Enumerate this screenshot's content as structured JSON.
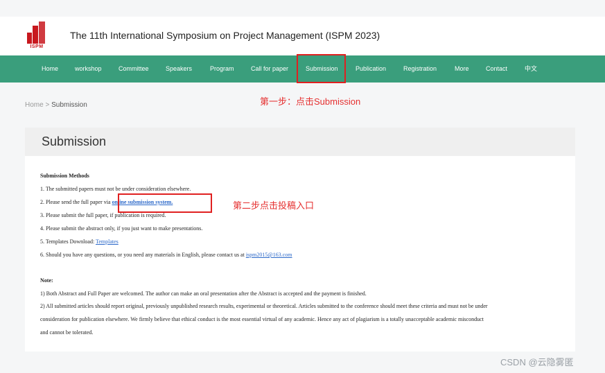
{
  "header": {
    "logo_text": "ISPM",
    "title": "The 11th International Symposium on Project Management (ISPM 2023)"
  },
  "nav": {
    "items": [
      "Home",
      "workshop",
      "Committee",
      "Speakers",
      "Program",
      "Call for paper",
      "Submission",
      "Publication",
      "Registration",
      "More",
      "Contact",
      "中文"
    ]
  },
  "annotations": {
    "step1": "第一步：点击Submission",
    "step2": "第二步点击投稿入口"
  },
  "breadcrumb": {
    "home": "Home",
    "separator": ">",
    "current": "Submission"
  },
  "page_title": "Submission",
  "methods": {
    "heading": "Submission Methods",
    "item1": "1. The submitted papers must not be under consideration elsewhere.",
    "item2_prefix": "2. Please send the full paper via ",
    "item2_link": "online submission system.",
    "item3": "3. Please submit the full paper, if publication is required.",
    "item4": "4. Please submit the abstract only, if you just want to make presentations.",
    "item5_prefix": "5. Templates Download: ",
    "item5_link": "Templates",
    "item6_prefix": "6. Should you have any questions, or you need any materials in English, please contact us at ",
    "item6_link": "ispm2015@163.com"
  },
  "note": {
    "heading": "Note:",
    "line1": "1) Both Abstract and Full Paper are welcomed. The author can make an oral presentation after the Abstract is accepted and the payment is finished.",
    "line2a": "2) All submitted articles should report original, previously unpublished research results, experimental or theoretical. Articles submitted to the conference should meet these criteria and must not be under",
    "line2b": "consideration for publication elsewhere. We firmly believe that ethical conduct is the most essential virtual of any academic. Hence any act of plagiarism is a totally unacceptable academic misconduct",
    "line2c": "and cannot be tolerated."
  },
  "watermark": "CSDN @云隐雾匿",
  "colors": {
    "nav_bg": "#3a9e7c",
    "annotation_red": "#e53030",
    "link_blue": "#2b68c9",
    "logo_red": "#c8181e"
  }
}
